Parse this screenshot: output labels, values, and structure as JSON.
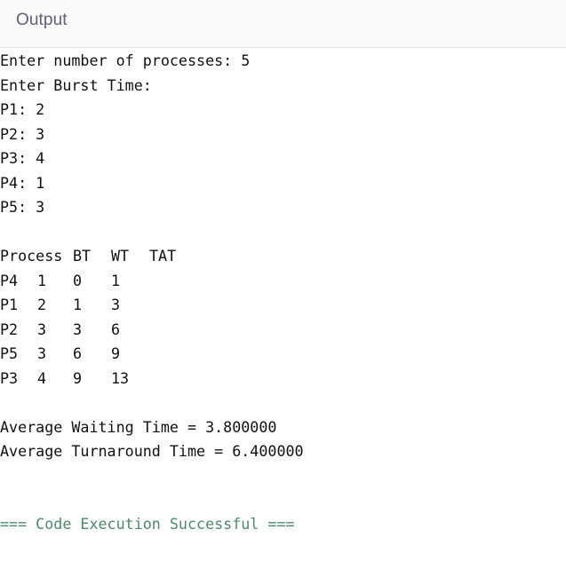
{
  "header": {
    "title": "Output"
  },
  "console": {
    "prompt_count": "Enter number of processes: 5",
    "prompt_burst": "Enter Burst Time:",
    "burst_inputs": [
      "P1: 2",
      "P2: 3",
      "P3: 4",
      "P4: 1",
      "P5: 3"
    ],
    "table": {
      "headers": [
        "Process",
        "BT",
        "WT",
        "TAT"
      ],
      "rows": [
        [
          "P4",
          "1",
          "0",
          "1"
        ],
        [
          "P1",
          "2",
          "1",
          "3"
        ],
        [
          "P2",
          "3",
          "3",
          "6"
        ],
        [
          "P5",
          "3",
          "6",
          "9"
        ],
        [
          "P3",
          "4",
          "9",
          "13"
        ]
      ]
    },
    "avg_waiting": "Average Waiting Time = 3.800000",
    "avg_turnaround": "Average Turnaround Time = 6.400000",
    "status": "=== Code Execution Successful ==="
  },
  "colors": {
    "title": "#5f5f78",
    "text": "#111111",
    "success": "#4d8a6a"
  }
}
